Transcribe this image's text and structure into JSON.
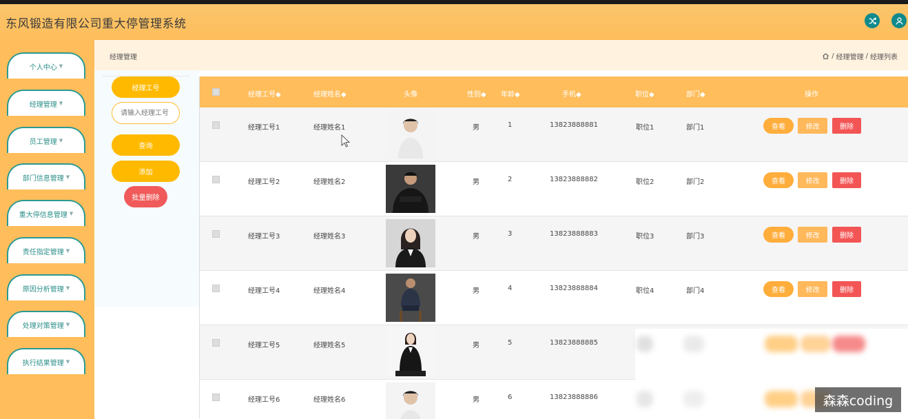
{
  "app": {
    "title": "东风锻造有限公司重大停管理系统"
  },
  "header_icons": [
    "shuffle-icon",
    "user-icon"
  ],
  "sidebar": {
    "items": [
      {
        "label": "个人中心"
      },
      {
        "label": "经理管理"
      },
      {
        "label": "员工管理"
      },
      {
        "label": "部门信息管理"
      },
      {
        "label": "重大停信息管理"
      },
      {
        "label": "责任指定管理"
      },
      {
        "label": "原因分析管理"
      },
      {
        "label": "处理对策管理"
      },
      {
        "label": "执行结果管理"
      }
    ]
  },
  "breadcrumb": {
    "title": "经理管理",
    "path": [
      "经理管理",
      "经理列表"
    ],
    "separator": "/"
  },
  "search": {
    "field_label": "经理工号",
    "placeholder": "请输入经理工号",
    "query_label": "查询",
    "add_label": "添加",
    "batch_delete_label": "批量删除"
  },
  "table": {
    "headers": [
      "经理工号◆",
      "经理姓名◆",
      "头像",
      "性别◆",
      "年龄◆",
      "手机◆",
      "职位◆",
      "部门◆",
      "操作"
    ],
    "actions": {
      "view": "查看",
      "edit": "修改",
      "delete": "删除"
    },
    "rows": [
      {
        "id": "经理工号1",
        "name": "经理姓名1",
        "gender": "男",
        "age": "1",
        "phone": "13823888881",
        "position": "职位1",
        "department": "部门1"
      },
      {
        "id": "经理工号2",
        "name": "经理姓名2",
        "gender": "男",
        "age": "2",
        "phone": "13823888882",
        "position": "职位2",
        "department": "部门2"
      },
      {
        "id": "经理工号3",
        "name": "经理姓名3",
        "gender": "男",
        "age": "3",
        "phone": "13823888883",
        "position": "职位3",
        "department": "部门3"
      },
      {
        "id": "经理工号4",
        "name": "经理姓名4",
        "gender": "男",
        "age": "4",
        "phone": "13823888884",
        "position": "职位4",
        "department": "部门4"
      },
      {
        "id": "经理工号5",
        "name": "经理姓名5",
        "gender": "男",
        "age": "5",
        "phone": "13823888885",
        "position": "",
        "department": ""
      },
      {
        "id": "经理工号6",
        "name": "经理姓名6",
        "gender": "男",
        "age": "6",
        "phone": "13823888886",
        "position": "",
        "department": ""
      }
    ]
  },
  "watermark": "森森coding",
  "colors": {
    "primary": "#ffbd5b",
    "teal": "#2a9a93",
    "danger": "#f35555",
    "button": "#ffba00"
  }
}
